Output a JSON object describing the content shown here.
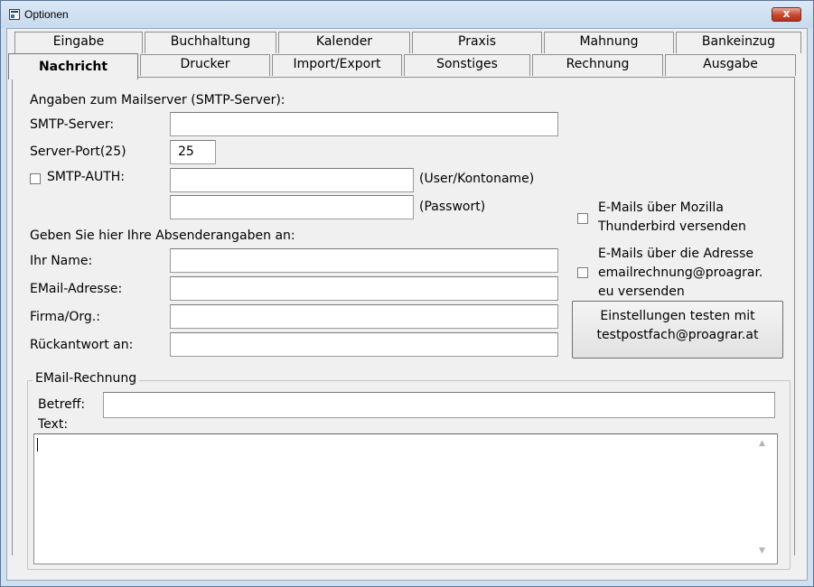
{
  "window": {
    "title": "Optionen",
    "close_glyph": "x"
  },
  "tabs_top": [
    "Eingabe",
    "Buchhaltung",
    "Kalender",
    "Praxis",
    "Mahnung",
    "Bankeinzug"
  ],
  "tabs_bottom": [
    "Nachricht",
    "Drucker",
    "Import/Export",
    "Sonstiges",
    "Rechnung",
    "Ausgabe"
  ],
  "active_tab": "Nachricht",
  "mailserver": {
    "heading": "Angaben zum Mailserver (SMTP-Server):",
    "smtp_label": "SMTP-Server:",
    "smtp_value": "",
    "port_label": "Server-Port(25)",
    "port_value": "25",
    "auth_label": "SMTP-AUTH:",
    "auth_checked": false,
    "user_value": "",
    "user_hint": "(User/Kontoname)",
    "password_value": "",
    "password_hint": "(Passwort)"
  },
  "sender": {
    "heading": "Geben Sie hier Ihre Absenderangaben an:",
    "name_label": "Ihr Name:",
    "name_value": "",
    "email_label": "EMail-Adresse:",
    "email_value": "",
    "company_label": "Firma/Org.:",
    "company_value": "",
    "reply_label": "Rückantwort an:",
    "reply_value": ""
  },
  "options": {
    "thunderbird_line1": "E-Mails über Mozilla",
    "thunderbird_line2": "Thunderbird versenden",
    "thunderbird_checked": false,
    "proagrar_line1": "E-Mails über die Adresse",
    "proagrar_line2": "emailrechnung@proagrar.",
    "proagrar_line3": "eu versenden",
    "proagrar_checked": false,
    "test_button_line1": "Einstellungen testen mit",
    "test_button_line2": "testpostfach@proagrar.at"
  },
  "invoice": {
    "group_title": "EMail-Rechnung",
    "subject_label": "Betreff:",
    "subject_value": "",
    "text_label": "Text:",
    "text_value": ""
  }
}
